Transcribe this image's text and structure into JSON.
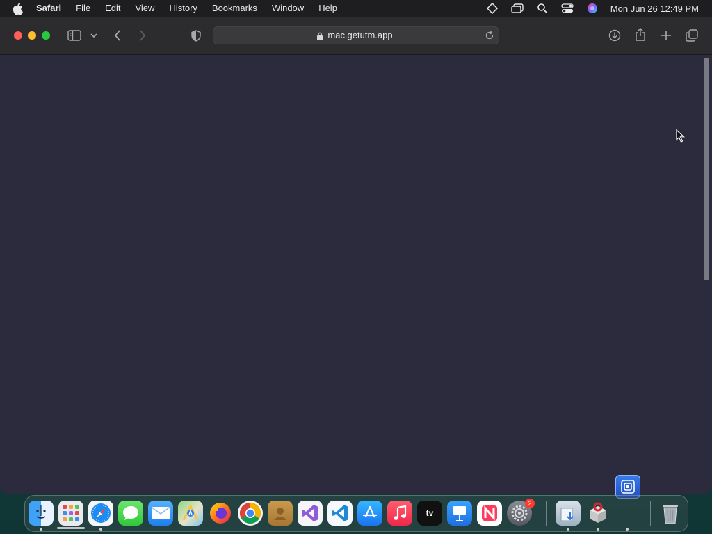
{
  "menubar": {
    "app_name": "Safari",
    "items": [
      "File",
      "Edit",
      "View",
      "History",
      "Bookmarks",
      "Window",
      "Help"
    ],
    "clock": "Mon Jun 26  12:49 PM"
  },
  "browser": {
    "url": "mac.getutm.app",
    "background_color": "#2b2b3d"
  },
  "dock": {
    "apps": [
      "Finder",
      "Launchpad",
      "Safari",
      "Messages",
      "Mail",
      "Maps",
      "Firefox",
      "Chrome",
      "Contacts",
      "Visual Studio",
      "VS Code",
      "App Store",
      "Music",
      "TV",
      "Keynote",
      "News",
      "System Settings",
      "Downloads",
      "Archive Utility",
      "Trash"
    ],
    "tv_label": "tv",
    "settings_badge": "2"
  }
}
